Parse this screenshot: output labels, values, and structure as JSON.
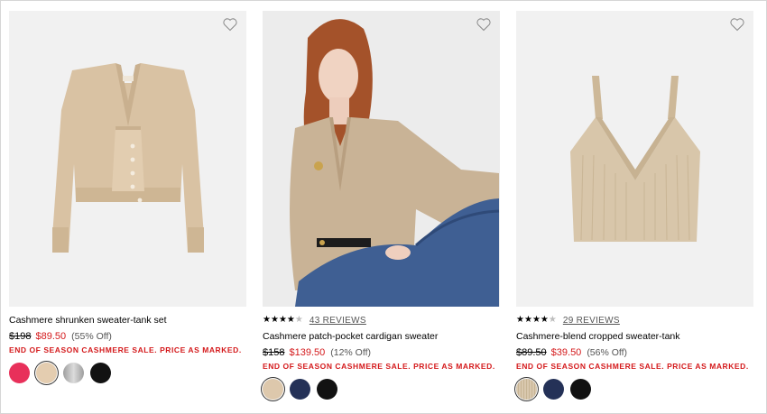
{
  "products": [
    {
      "title": "Cashmere shrunken sweater-tank set",
      "rating": null,
      "reviews_label": "",
      "price_was": "$198",
      "price_now": "$89.50",
      "price_off": "(55% Off)",
      "promo": "END OF SEASON CASHMERE SALE. PRICE AS MARKED.",
      "swatches": [
        {
          "color": "#e8305a",
          "name": "pink"
        },
        {
          "color": "#e4cdb0",
          "name": "oatmeal",
          "selected": true
        },
        {
          "color": "#b9b9b9",
          "name": "grey-heather"
        },
        {
          "color": "#121212",
          "name": "black"
        }
      ]
    },
    {
      "title": "Cashmere patch-pocket cardigan sweater",
      "rating": 4,
      "reviews_label": "43 REVIEWS",
      "price_was": "$158",
      "price_now": "$139.50",
      "price_off": "(12% Off)",
      "promo": "END OF SEASON CASHMERE SALE. PRICE AS MARKED.",
      "swatches": [
        {
          "color": "#ddc8ac",
          "name": "oatmeal",
          "selected": true
        },
        {
          "color": "#243157",
          "name": "navy"
        },
        {
          "color": "#121212",
          "name": "black"
        }
      ]
    },
    {
      "title": "Cashmere-blend cropped sweater-tank",
      "rating": 4,
      "reviews_label": "29 REVIEWS",
      "price_was": "$89.50",
      "price_now": "$39.50",
      "price_off": "(56% Off)",
      "promo": "END OF SEASON CASHMERE SALE. PRICE AS MARKED.",
      "swatches": [
        {
          "color": "#d9c8ae",
          "name": "oatmeal",
          "selected": true
        },
        {
          "color": "#243157",
          "name": "navy"
        },
        {
          "color": "#121212",
          "name": "black"
        }
      ]
    }
  ],
  "icons": {
    "favorite": "heart-outline-icon",
    "star_full": "★",
    "star_empty": "★"
  },
  "colors": {
    "sale_red": "#d4191b",
    "image_bg": "#f1f1f1",
    "text_muted": "#555555"
  }
}
